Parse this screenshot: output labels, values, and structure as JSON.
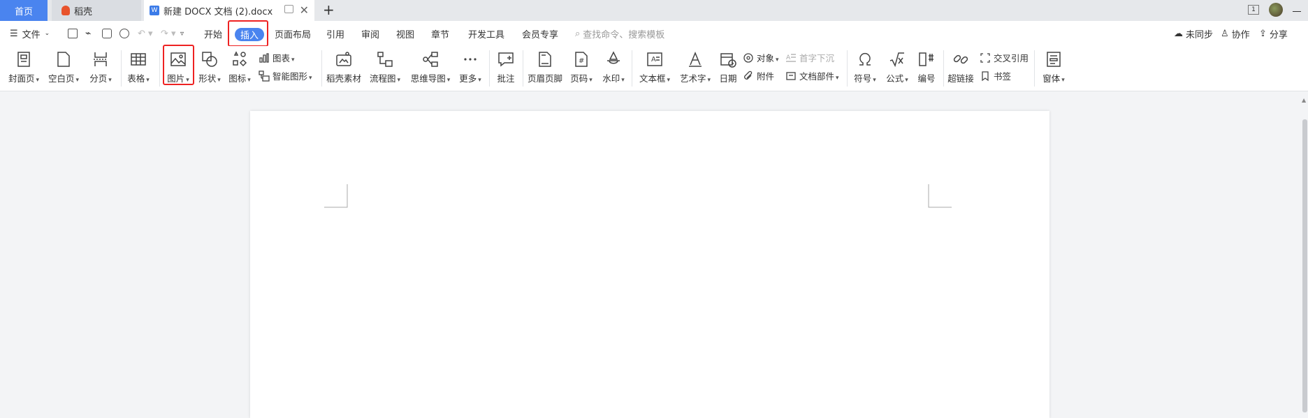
{
  "tabs": {
    "home": "首页",
    "daoke": "稻壳",
    "doc": "新建 DOCX 文档 (2).docx",
    "new_tab": "+"
  },
  "window": {
    "badge": "1"
  },
  "menu": {
    "file": "文件",
    "items": [
      "开始",
      "插入",
      "页面布局",
      "引用",
      "审阅",
      "视图",
      "章节",
      "开发工具",
      "会员专享"
    ],
    "search_placeholder": "查找命令、搜索模板",
    "sync": "未同步",
    "collab": "协作",
    "share": "分享",
    "active": "插入"
  },
  "ribbon": {
    "cover": "封面页",
    "blank": "空白页",
    "pagebreak": "分页",
    "table": "表格",
    "picture": "图片",
    "shape": "形状",
    "icon": "图标",
    "chart": "图表",
    "smartart": "智能图形",
    "daoke_material": "稻壳素材",
    "flowchart": "流程图",
    "mindmap": "思维导图",
    "more": "更多",
    "comment": "批注",
    "header_footer": "页眉页脚",
    "page_num": "页码",
    "watermark": "水印",
    "textbox": "文本框",
    "wordart": "艺术字",
    "date": "日期",
    "object": "对象",
    "attachment": "附件",
    "dropcap": "首字下沉",
    "docparts": "文档部件",
    "symbol": "符号",
    "formula": "公式",
    "numbering": "编号",
    "hyperlink": "超链接",
    "crossref": "交叉引用",
    "bookmark": "书签",
    "window_body": "窗体"
  },
  "colors": {
    "accent": "#4a84ef",
    "highlight": "#e22222"
  }
}
